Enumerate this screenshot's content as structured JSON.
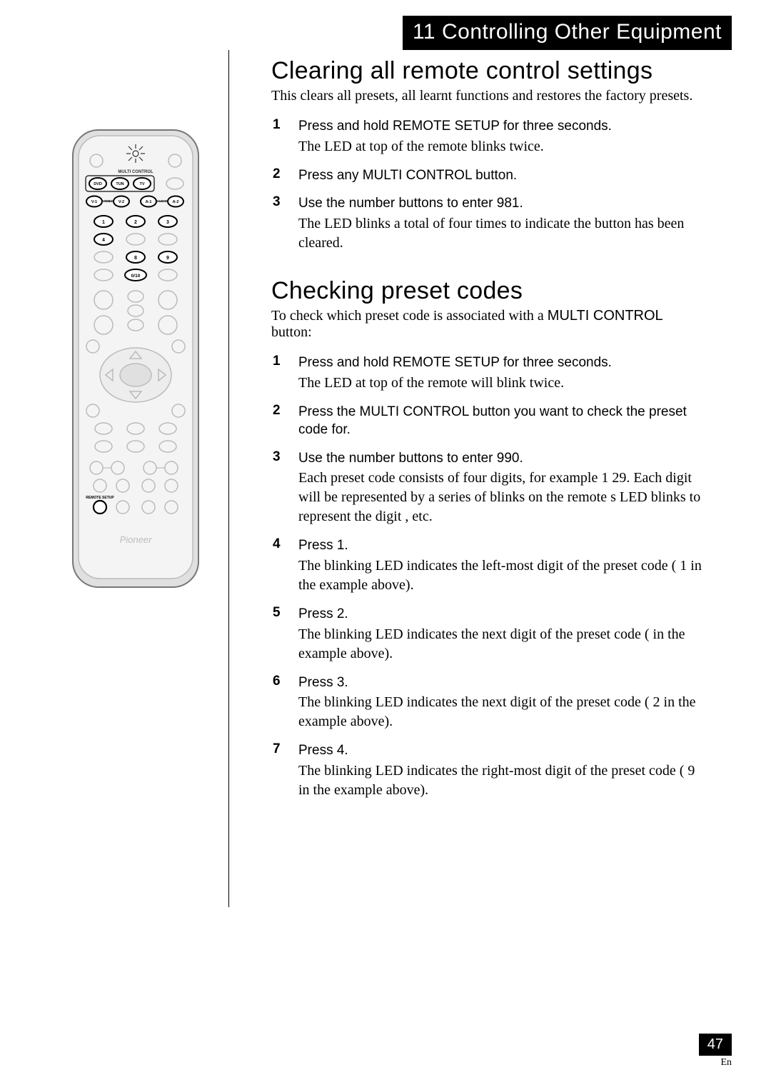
{
  "chapter": {
    "number": "11",
    "title": "Controlling Other Equipment"
  },
  "section1": {
    "title": "Clearing all remote control settings",
    "intro": "This clears all presets, all learnt functions and restores the factory presets.",
    "steps": [
      {
        "n": "1",
        "head": "Press and hold REMOTE SETUP for three seconds.",
        "body": "The LED at top of the remote blinks twice."
      },
      {
        "n": "2",
        "head": "Press any MULTI CONTROL button.",
        "body": ""
      },
      {
        "n": "3",
        "head": "Use the number buttons to enter 981.",
        "body": "The LED blinks a total of four times to indicate the button has been cleared."
      }
    ]
  },
  "section2": {
    "title": "Checking preset codes",
    "intro_pre": "To check which preset code is associated with a ",
    "intro_bold": "MULTI CONTROL",
    "intro_post": " button:",
    "steps": [
      {
        "n": "1",
        "head": "Press and hold REMOTE SETUP for three seconds.",
        "body": "The LED at top of the remote will blink twice."
      },
      {
        "n": "2",
        "head": "Press the MULTI CONTROL button you want to check the preset code for.",
        "body": ""
      },
      {
        "n": "3",
        "head": "Use the number buttons to enter 990.",
        "body": "Each preset code consists of four digits, for example 1  29. Each digit will be represented by a series of blinks on the remote s LED        blinks to represent the digit      , etc."
      },
      {
        "n": "4",
        "head": "Press 1.",
        "body": "The blinking LED indicates the left-most digit of the preset code (  1   in the example above)."
      },
      {
        "n": "5",
        "head": "Press 2.",
        "body": "The blinking LED indicates the next digit of the preset code (       in the example above)."
      },
      {
        "n": "6",
        "head": "Press 3.",
        "body": "The blinking LED indicates the next digit of the preset code (  2   in the example above)."
      },
      {
        "n": "7",
        "head": "Press 4.",
        "body": "The blinking LED indicates the right-most digit of the preset code (  9   in the example above)."
      }
    ]
  },
  "remote": {
    "multi_control_label": "MULTI CONTROL",
    "buttons": {
      "dvd": "DVD",
      "tun": "TUN",
      "tv": "TV",
      "v1": "V-1",
      "v2": "V-2",
      "a1": "A-1",
      "a2": "A-2"
    },
    "video_label": "VIDEO",
    "audio_label": "AUDIO",
    "numpad": {
      "1": "1",
      "2": "2",
      "3": "3",
      "4": "4",
      "8": "8",
      "9": "9",
      "010": "0/10"
    },
    "remote_setup_label": "REMOTE SETUP",
    "brand": "Pioneer"
  },
  "page": {
    "number": "47",
    "lang": "En"
  }
}
